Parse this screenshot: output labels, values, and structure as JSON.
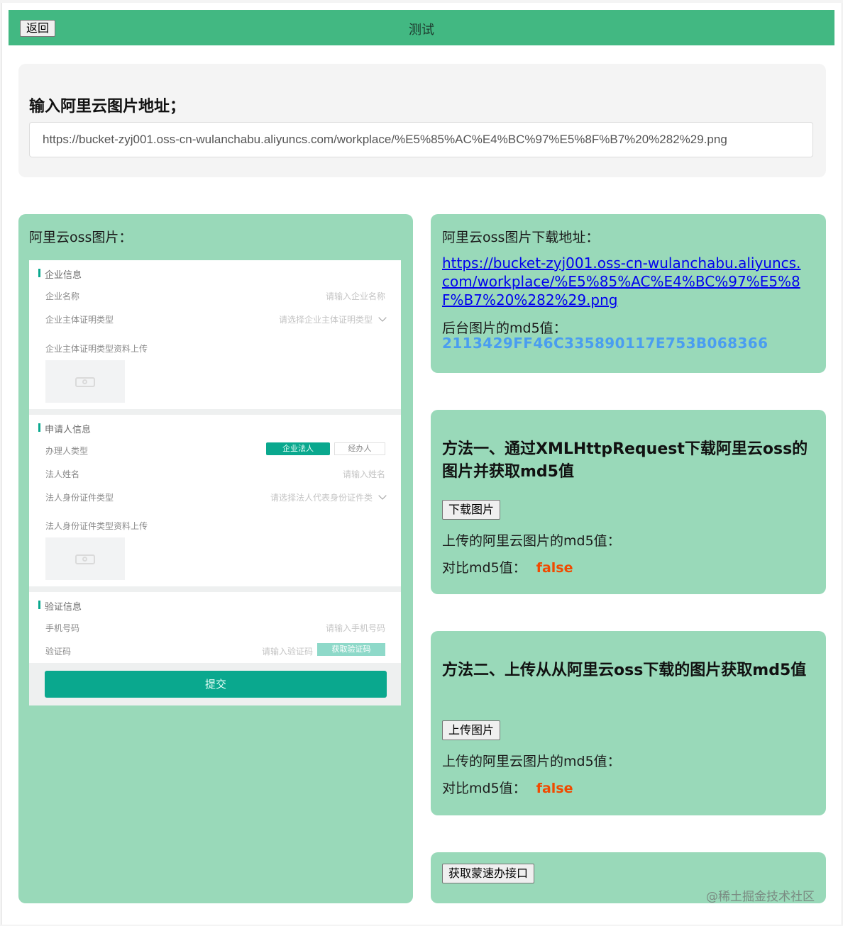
{
  "header": {
    "back_label": "返回",
    "title": "测试"
  },
  "url_section": {
    "label": "输入阿里云图片地址；",
    "value": "https://bucket-zyj001.oss-cn-wulanchabu.aliyuncs.com/workplace/%E5%85%AC%E4%BC%97%E5%8F%B7%20%282%29.png"
  },
  "oss_image": {
    "label": "阿里云oss图片：",
    "preview": {
      "section_company": "企业信息",
      "company_name_label": "企业名称",
      "company_name_placeholder": "请输入企业名称",
      "cert_type_label": "企业主体证明类型",
      "cert_type_placeholder": "请选择企业主体证明类型",
      "cert_upload_label": "企业主体证明类型资料上传",
      "section_applicant": "申请人信息",
      "applicant_type_label": "办理人类型",
      "applicant_type_option_1": "企业法人",
      "applicant_type_option_2": "经办人",
      "legal_name_label": "法人姓名",
      "legal_name_placeholder": "请输入姓名",
      "legal_id_type_label": "法人身份证件类型",
      "legal_id_type_placeholder": "请选择法人代表身份证件类",
      "legal_id_upload_label": "法人身份证件类型资料上传",
      "section_verify": "验证信息",
      "phone_label": "手机号码",
      "phone_placeholder": "请输入手机号码",
      "code_label": "验证码",
      "code_placeholder": "请输入验证码",
      "code_button": "获取验证码",
      "submit_label": "提交"
    }
  },
  "download_info": {
    "label": "阿里云oss图片下载地址：",
    "url": "https://bucket-zyj001.oss-cn-wulanchabu.aliyuncs.com/workplace/%E5%85%AC%E4%BC%97%E5%8F%B7%20%282%29.png",
    "md5_label": "后台图片的md5值：",
    "md5_value": "2113429FF46C335890117E753B068366"
  },
  "method1": {
    "title": "方法一、通过XMLHttpRequest下载阿里云oss的图片并获取md5值",
    "button": "下载图片",
    "md5_label": "上传的阿里云图片的md5值：",
    "compare_label": "对比md5值：",
    "compare_value": "false"
  },
  "method2": {
    "title": "方法二、上传从从阿里云oss下载的图片获取md5值",
    "button": "上传图片",
    "md5_label": "上传的阿里云图片的md5值：",
    "compare_label": "对比md5值：",
    "compare_value": "false"
  },
  "api_section": {
    "button": "获取蒙速办接口"
  },
  "watermark": "@稀土掘金技术社区",
  "colors": {
    "header_green": "#42b882",
    "card_green": "#99d9b9",
    "md5_blue": "#4a9df0",
    "false_orange": "#f04a00"
  }
}
